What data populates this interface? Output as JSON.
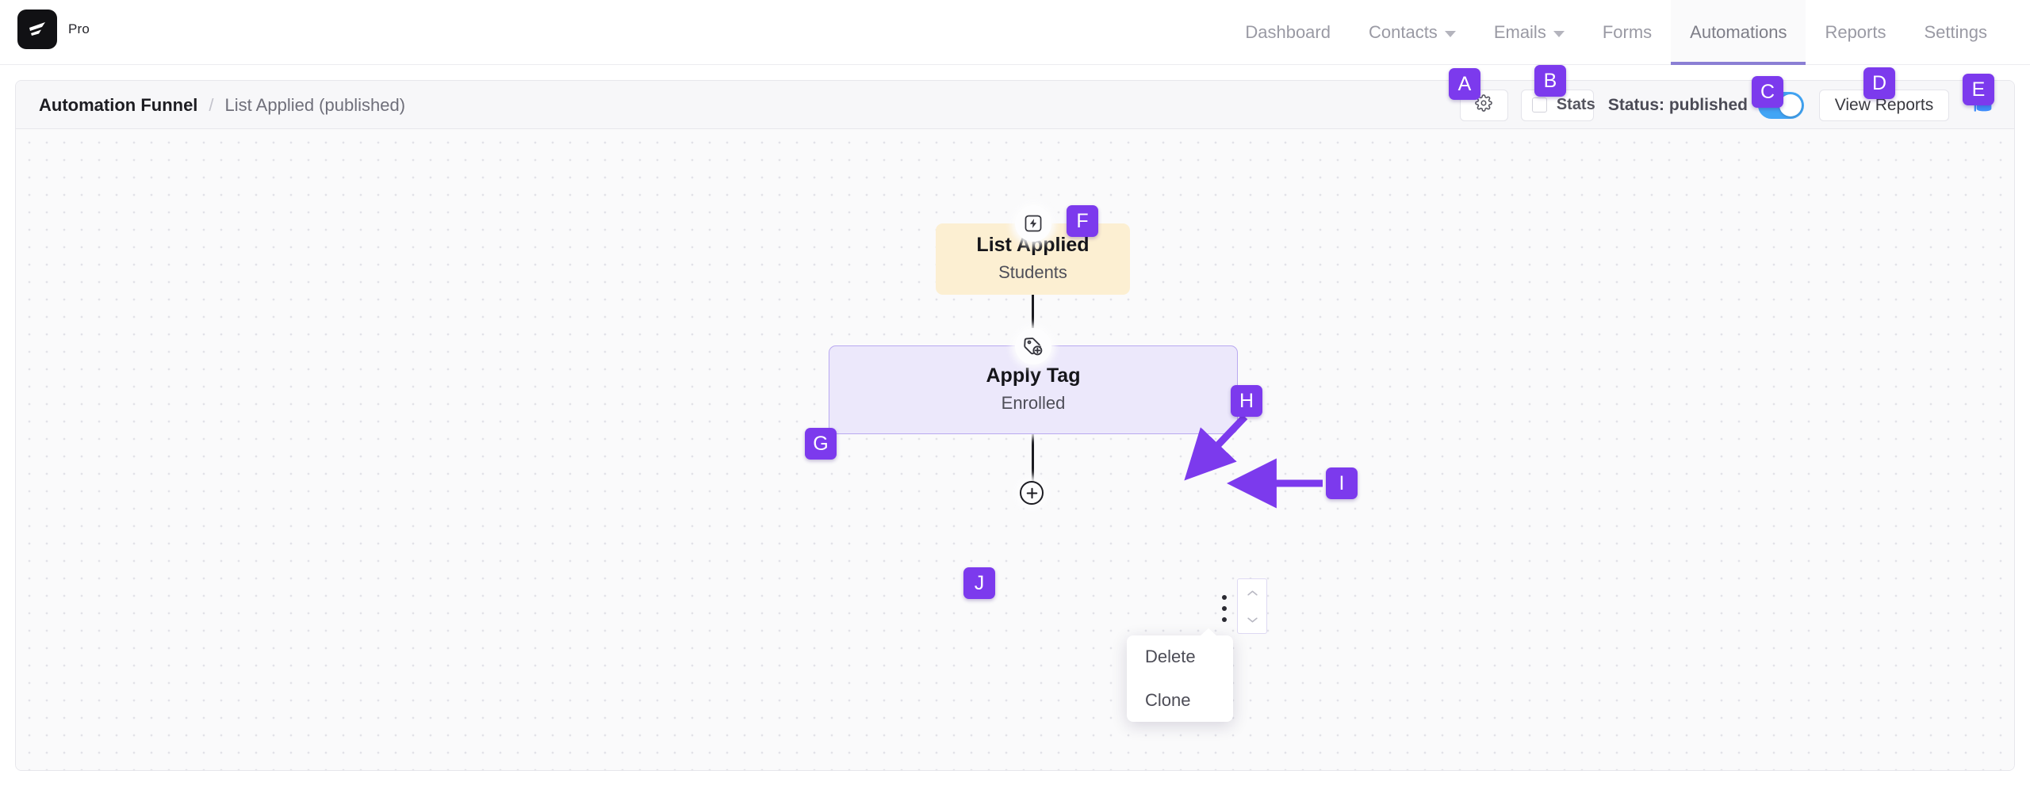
{
  "brand": {
    "logo_icon": "swoosh-logo-icon",
    "tier_label": "Pro"
  },
  "nav": {
    "items": [
      {
        "label": "Dashboard",
        "active": false,
        "has_caret": false
      },
      {
        "label": "Contacts",
        "active": false,
        "has_caret": true
      },
      {
        "label": "Emails",
        "active": false,
        "has_caret": true
      },
      {
        "label": "Forms",
        "active": false,
        "has_caret": false
      },
      {
        "label": "Automations",
        "active": true,
        "has_caret": false
      },
      {
        "label": "Reports",
        "active": false,
        "has_caret": false
      },
      {
        "label": "Settings",
        "active": false,
        "has_caret": false
      }
    ]
  },
  "breadcrumb": {
    "root": "Automation Funnel",
    "separator": "/",
    "leaf": "List Applied (published)"
  },
  "toolbar": {
    "gear_icon": "gear-icon",
    "stats_label": "Stats",
    "stats_checked": false,
    "status_label": "Status: published",
    "status_toggle_on": true,
    "status_toggle_color": "#42a5f5",
    "view_reports_label": "View Reports",
    "graduation_cap_icon": "graduation-cap-icon",
    "graduation_cap_color": "#3f8efc"
  },
  "canvas": {
    "trigger_node": {
      "icon": "lightning-bolt-icon",
      "title": "List Applied",
      "subtitle": "Students",
      "color": "#fcefd2"
    },
    "action_node": {
      "icon": "tag-plus-icon",
      "title": "Apply Tag",
      "subtitle": "Enrolled",
      "color": "#ece8fb",
      "border_color": "#b9a9f0"
    },
    "add_step_top_icon": "plus-circle-icon",
    "add_step_bottom_icon": "plus-circle-icon",
    "kebab_icon": "vertical-dots-icon",
    "stepper": {
      "up_icon": "chevron-up-icon",
      "down_icon": "chevron-down-icon"
    },
    "context_menu": {
      "items": [
        "Delete",
        "Clone"
      ]
    }
  },
  "annotations": {
    "accent_color": "#7c3aed",
    "labels": {
      "A": "A",
      "B": "B",
      "C": "C",
      "D": "D",
      "E": "E",
      "F": "F",
      "G": "G",
      "H": "H",
      "I": "I",
      "J": "J"
    }
  }
}
